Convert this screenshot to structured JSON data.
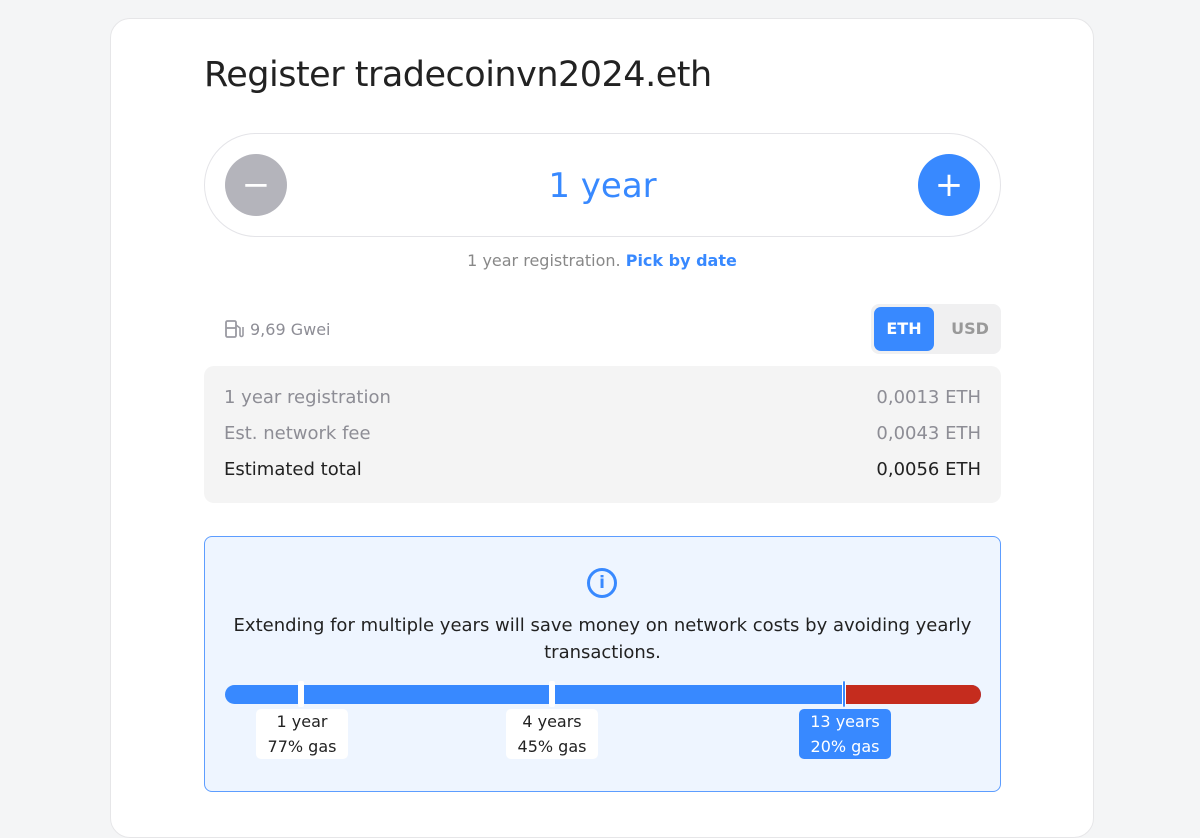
{
  "title": "Register tradecoinvn2024.eth",
  "duration": {
    "value": "1 year",
    "minus": "−",
    "plus": "+"
  },
  "subtitle": {
    "text": "1 year registration.",
    "link": "Pick by date"
  },
  "gas": {
    "icon": "gas-pump-icon",
    "value": "9,69 Gwei"
  },
  "currency": {
    "options": [
      "ETH",
      "USD"
    ],
    "selected": "ETH"
  },
  "prices": [
    {
      "label": "1 year registration",
      "value": "0,0013 ETH"
    },
    {
      "label": "Est. network fee",
      "value": "0,0043 ETH"
    },
    {
      "label": "Estimated total",
      "value": "0,0056 ETH"
    }
  ],
  "info": {
    "icon": "info-icon",
    "text": "Extending for multiple years will save money on network costs by avoiding yearly transactions.",
    "markers": [
      {
        "years": "1 year",
        "gas": "77% gas"
      },
      {
        "years": "4 years",
        "gas": "45% gas"
      },
      {
        "years": "13 years",
        "gas": "20% gas",
        "selected": true
      }
    ]
  },
  "colors": {
    "accent": "#3889ff",
    "danger": "#c52c1e"
  }
}
